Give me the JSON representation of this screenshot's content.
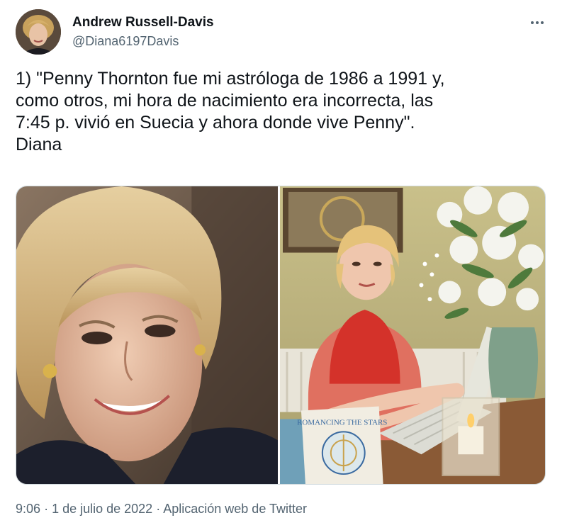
{
  "author": {
    "display_name": "Andrew Russell-Davis",
    "handle": "@Diana6197Davis",
    "avatar_icon": "profile-photo"
  },
  "more_icon": "more-options-icon",
  "tweet": {
    "text": "1) \"Penny Thornton fue mi astróloga de 1986 a 1991 y,\ncomo otros, mi hora de nacimiento era incorrecta, las\n7:45 p. vivió en Suecia y ahora donde vive Penny\".\nDiana"
  },
  "media": {
    "left_image": "portrait-photo",
    "right_image": "photo-woman-at-desk",
    "book_title": "ROMANCING THE STARS"
  },
  "meta": {
    "time": "9:06",
    "separator": "·",
    "date": "1 de julio de 2022",
    "source": "Aplicación web de Twitter"
  },
  "colors": {
    "text": "#0f1419",
    "secondary": "#536471",
    "border": "#cfd9de"
  }
}
